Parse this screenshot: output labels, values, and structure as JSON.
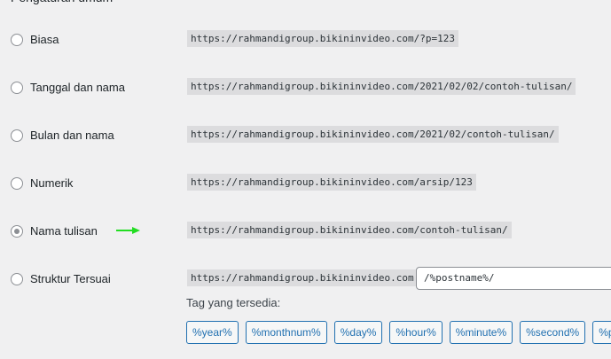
{
  "permalink_options": [
    {
      "label": "Biasa",
      "example": "https://rahmandigroup.bikininvideo.com/?p=123",
      "checked": false
    },
    {
      "label": "Tanggal dan nama",
      "example": "https://rahmandigroup.bikininvideo.com/2021/02/02/contoh-tulisan/",
      "checked": false
    },
    {
      "label": "Bulan dan nama",
      "example": "https://rahmandigroup.bikininvideo.com/2021/02/contoh-tulisan/",
      "checked": false
    },
    {
      "label": "Numerik",
      "example": "https://rahmandigroup.bikininvideo.com/arsip/123",
      "checked": false
    },
    {
      "label": "Nama tulisan",
      "example": "https://rahmandigroup.bikininvideo.com/contoh-tulisan/",
      "checked": true
    },
    {
      "label": "Struktur Tersuai",
      "example": "https://rahmandigroup.bikininvideo.com",
      "checked": false
    }
  ],
  "custom_structure": {
    "value": "/%postname%/"
  },
  "available_tags": {
    "title": "Tag yang tersedia:",
    "tags": [
      "%year%",
      "%monthnum%",
      "%day%",
      "%hour%",
      "%minute%",
      "%second%",
      "%p"
    ]
  },
  "colors": {
    "arrow": "#22dd22",
    "tag_border": "#2271b1",
    "background": "#f0f0f1"
  },
  "icons": {
    "annotation": "green-arrow-icon"
  }
}
